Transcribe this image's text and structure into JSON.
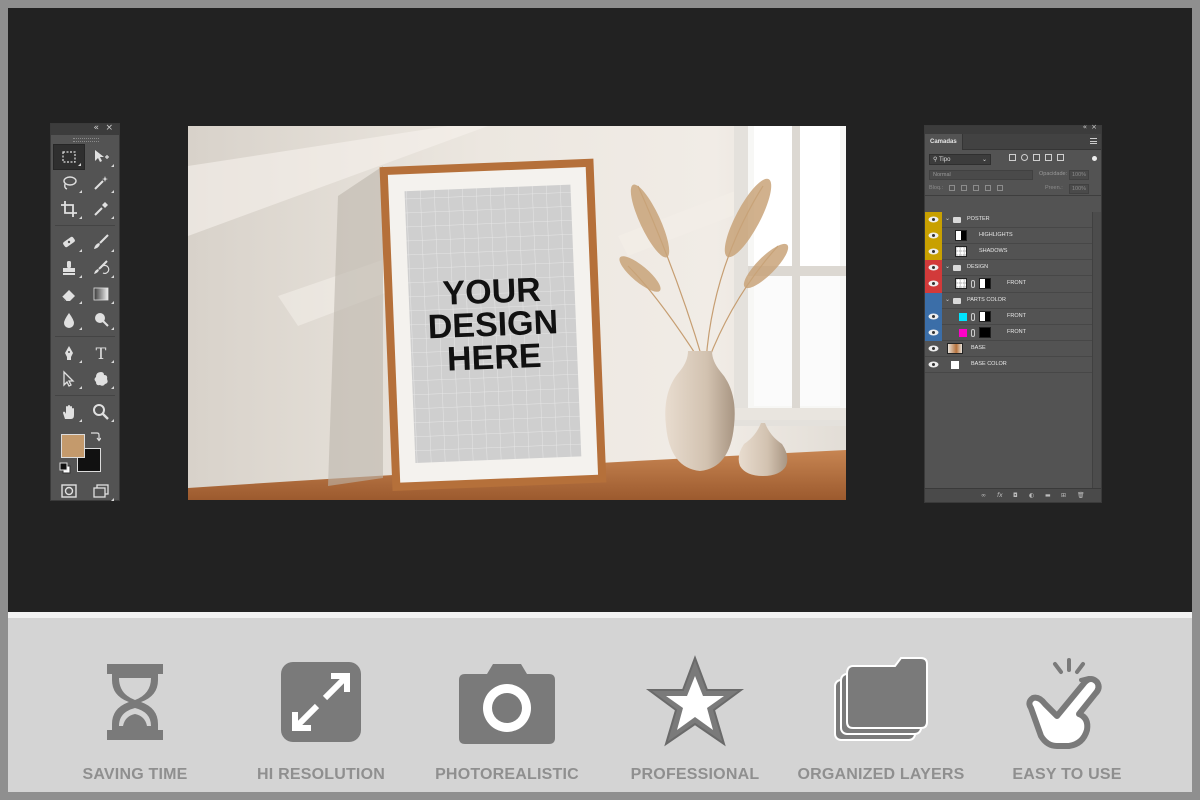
{
  "tools_panel": {
    "collapse_glyph": "«",
    "close_glyph": "×",
    "tools": [
      {
        "name": "rectangular-marquee-tool-icon"
      },
      {
        "name": "move-tool-icon"
      },
      {
        "name": "lasso-tool-icon"
      },
      {
        "name": "magic-wand-tool-icon"
      },
      {
        "name": "crop-tool-icon"
      },
      {
        "name": "eyedropper-tool-icon"
      },
      {
        "name": "spot-healing-tool-icon"
      },
      {
        "name": "brush-tool-icon"
      },
      {
        "name": "clone-stamp-tool-icon"
      },
      {
        "name": "history-brush-tool-icon"
      },
      {
        "name": "eraser-tool-icon"
      },
      {
        "name": "gradient-tool-icon"
      },
      {
        "name": "blur-tool-icon"
      },
      {
        "name": "dodge-tool-icon"
      },
      {
        "name": "pen-tool-icon"
      },
      {
        "name": "type-tool-icon"
      },
      {
        "name": "path-selection-tool-icon"
      },
      {
        "name": "custom-shape-tool-icon"
      },
      {
        "name": "hand-tool-icon"
      },
      {
        "name": "zoom-tool-icon"
      }
    ],
    "foreground_color": "#c49a6c",
    "background_color": "#111111",
    "type_tool_glyph": "T"
  },
  "canvas": {
    "mockup_text": [
      "YOUR",
      "DESIGN",
      "HERE"
    ],
    "frame_color": "#b5703a",
    "wall_color": "#ebe5dd"
  },
  "layers_panel": {
    "tab_label": "Camadas",
    "filter_kind": "Tipo",
    "blend_mode": "Normal",
    "opacity_label": "Opacidade:",
    "opacity_value": "100%",
    "lock_label": "Bloq.:",
    "fill_label": "Preen.:",
    "fill_value": "100%",
    "layers": [
      {
        "label": "POSTER",
        "type": "group",
        "color": "#c8a000",
        "indent": 0
      },
      {
        "label": "HIGHLIGHTS",
        "type": "layer",
        "color": "#c8a000",
        "indent": 1
      },
      {
        "label": "SHADOWS",
        "type": "layer",
        "color": "#c8a000",
        "indent": 1
      },
      {
        "label": "DESIGN",
        "type": "group",
        "color": "#d23a3a",
        "indent": 0
      },
      {
        "label": "FRONT",
        "type": "smart",
        "color": "#d23a3a",
        "indent": 1
      },
      {
        "label": "PARTS COLOR",
        "type": "group",
        "color": "#3b6ea8",
        "indent": 0
      },
      {
        "label": "FRONT",
        "type": "fill",
        "color": "#3b6ea8",
        "swatch": "#00e5ff",
        "indent": 1
      },
      {
        "label": "FRONT",
        "type": "fill",
        "color": "#3b6ea8",
        "swatch": "#ff00c8",
        "indent": 1
      },
      {
        "label": "BASE",
        "type": "image",
        "color": "",
        "indent": 0
      },
      {
        "label": "BASE COLOR",
        "type": "solid",
        "color": "",
        "indent": 0
      }
    ],
    "footer_icons": [
      "link-icon",
      "fx-icon",
      "mask-icon",
      "adjustment-icon",
      "folder-icon",
      "new-layer-icon",
      "trash-icon"
    ]
  },
  "features": [
    {
      "label": "SAVING TIME",
      "icon": "hourglass-icon"
    },
    {
      "label": "HI RESOLUTION",
      "icon": "expand-icon"
    },
    {
      "label": "PHOTOREALISTIC",
      "icon": "camera-icon"
    },
    {
      "label": "PROFESSIONAL",
      "icon": "star-icon"
    },
    {
      "label": "ORGANIZED LAYERS",
      "icon": "layers-icon"
    },
    {
      "label": "EASY TO USE",
      "icon": "tap-hand-icon"
    }
  ],
  "colors": {
    "workspace": "#222222",
    "panel": "#535353",
    "features_bg": "#d4d4d4",
    "feature_icon": "#7a7a7a",
    "feature_text": "#8f8f8f"
  }
}
